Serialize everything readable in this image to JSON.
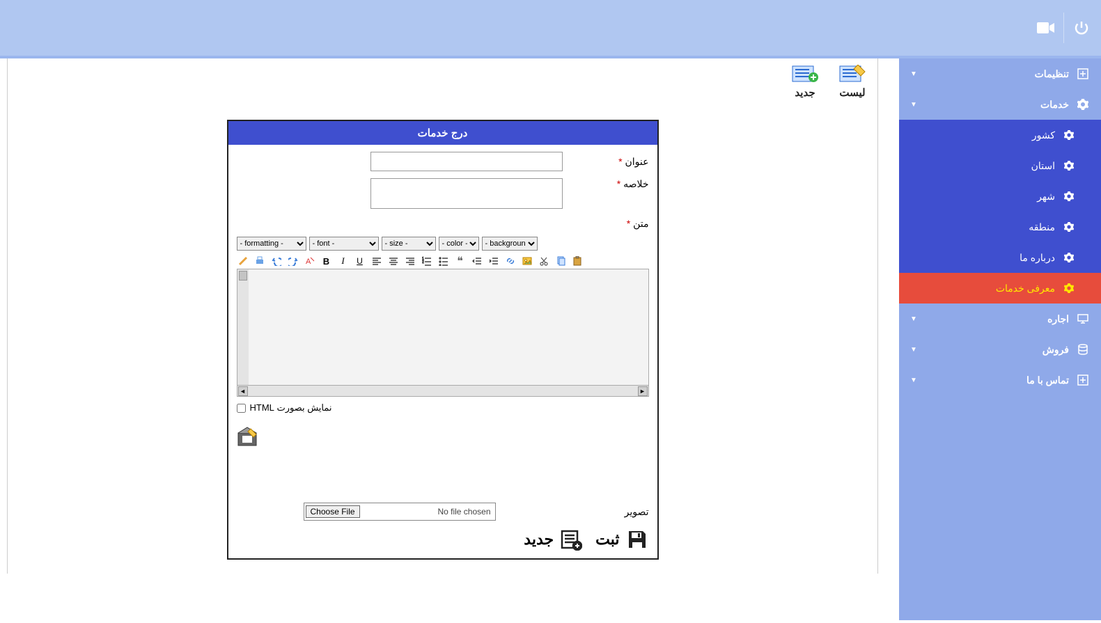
{
  "topbar": {
    "power_icon": "power",
    "video_icon": "video"
  },
  "sidebar": {
    "items": [
      {
        "id": "settings",
        "label": "تنظیمات",
        "icon": "plus-box",
        "caret": true,
        "level": 1
      },
      {
        "id": "services",
        "label": "خدمات",
        "icon": "gear",
        "caret": true,
        "level": 1
      },
      {
        "id": "country",
        "label": "کشور",
        "icon": "gear",
        "level": 2
      },
      {
        "id": "province",
        "label": "استان",
        "icon": "gear",
        "level": 2
      },
      {
        "id": "city",
        "label": "شهر",
        "icon": "gear",
        "level": 2
      },
      {
        "id": "region",
        "label": "منطقه",
        "icon": "gear",
        "level": 2
      },
      {
        "id": "about",
        "label": "درباره ما",
        "icon": "gear",
        "level": 2
      },
      {
        "id": "intro-services",
        "label": "معرفی خدمات",
        "icon": "gear",
        "level": 2,
        "active": true
      },
      {
        "id": "rent",
        "label": "اجاره",
        "icon": "monitor",
        "caret": true,
        "level": 1
      },
      {
        "id": "sale",
        "label": "فروش",
        "icon": "database",
        "caret": true,
        "level": 1
      },
      {
        "id": "contact",
        "label": "تماس با ما",
        "icon": "plus-box",
        "caret": true,
        "level": 1
      }
    ]
  },
  "top_actions": {
    "list": {
      "label": "لیست"
    },
    "new": {
      "label": "جدید"
    }
  },
  "panel": {
    "title": "درج خدمات",
    "title_label": "عنوان",
    "summary_label": "خلاصه",
    "text_label": "متن",
    "required_mark": "*"
  },
  "editor": {
    "formatting_opt": "- formatting -",
    "font_opt": "- font -",
    "size_opt": "- size -",
    "color_opt": "- color -",
    "background_opt": "- background -",
    "html_view_label": "نمایش بصورت HTML"
  },
  "image_row": {
    "label": "تصویر",
    "choose_btn": "Choose File",
    "no_file": "No file chosen"
  },
  "bottom": {
    "submit": "ثبت",
    "new": "جدید"
  }
}
